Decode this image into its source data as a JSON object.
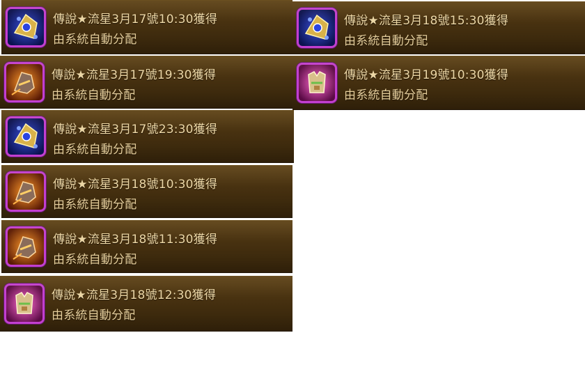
{
  "log_entries": [
    {
      "text": "傳說★流星3月17號10:30獲得",
      "subtext": "由系統自動分配",
      "item_icon": "blue-gold-fan-icon"
    },
    {
      "text": "傳說★流星3月17號19:30獲得",
      "subtext": "由系統自動分配",
      "item_icon": "orange-armor-boot-icon"
    },
    {
      "text": "傳說★流星3月17號23:30獲得",
      "subtext": "由系統自動分配",
      "item_icon": "blue-gold-fan-icon"
    },
    {
      "text": "傳說★流星3月18號10:30獲得",
      "subtext": "由系統自動分配",
      "item_icon": "orange-armor-boot-icon"
    },
    {
      "text": "傳說★流星3月18號11:30獲得",
      "subtext": "由系統自動分配",
      "item_icon": "orange-armor-boot-icon"
    },
    {
      "text": "傳說★流星3月18號12:30獲得",
      "subtext": "由系統自動分配",
      "item_icon": "pink-armor-vest-icon"
    },
    {
      "text": "傳說★流星3月18號15:30獲得",
      "subtext": "由系統自動分配",
      "item_icon": "blue-gold-fan-icon"
    },
    {
      "text": "傳說★流星3月19號10:30獲得",
      "subtext": "由系統自動分配",
      "item_icon": "pink-armor-vest-icon"
    }
  ],
  "colors": {
    "text": "#ecd7a6",
    "frame": "#c23fd0",
    "panel": "#4a3311"
  }
}
